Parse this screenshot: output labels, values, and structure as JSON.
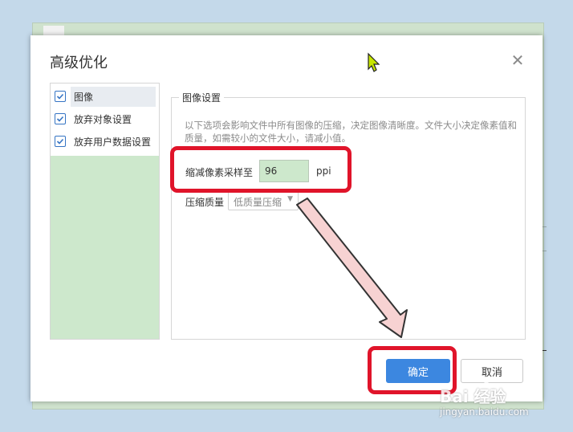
{
  "dialog": {
    "title": "高级优化",
    "close_glyph": "✕"
  },
  "sidebar": {
    "items": [
      {
        "label": "图像",
        "checked": true,
        "selected": true
      },
      {
        "label": "放弃对象设置",
        "checked": true,
        "selected": false
      },
      {
        "label": "放弃用户数据设置",
        "checked": true,
        "selected": false
      }
    ]
  },
  "image_settings": {
    "group_title": "图像设置",
    "description": "以下选项会影响文件中所有图像的压缩，决定图像清晰度。文件大小决定像素值和质量，如需较小的文件大小，请减小值。",
    "downsample_label": "缩减像素采样至",
    "downsample_value": "96",
    "downsample_unit": "ppi",
    "quality_label": "压缩质量",
    "quality_value": "低质量压缩"
  },
  "buttons": {
    "ok_label": "确定",
    "cancel_label": "取消"
  },
  "watermark": {
    "brand": "Bai 经验",
    "url": "jingyan.baidu.com"
  },
  "colors": {
    "accent": "#3c87e0",
    "highlight": "#e0142a",
    "sidebar_bg": "#cde8cc"
  }
}
